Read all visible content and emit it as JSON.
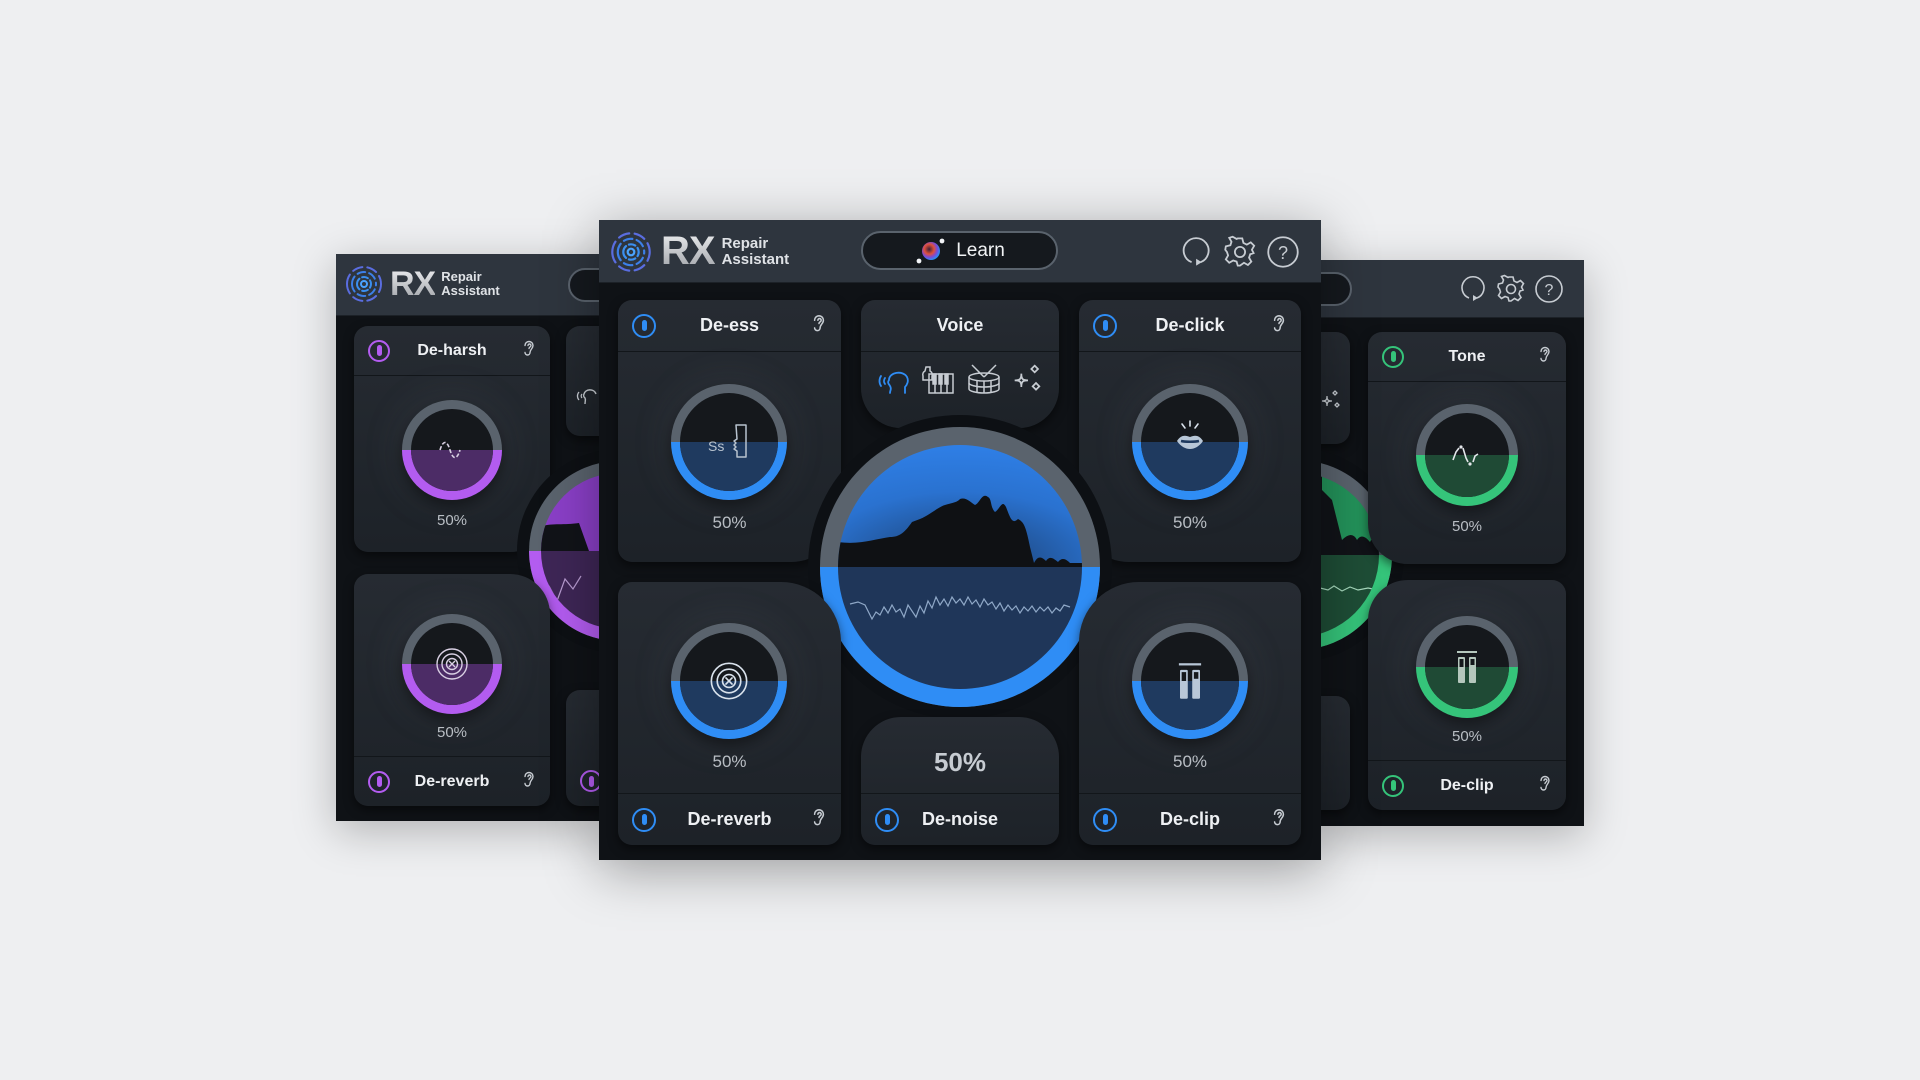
{
  "app": {
    "logo_text": "RX",
    "logo_sub_line1": "Repair",
    "logo_sub_line2": "Assistant",
    "learn_label": "Learn"
  },
  "icons": {
    "logo": "rx-logo-icon",
    "learn": "learn-orb-icon",
    "history": "history-icon",
    "settings": "gear-icon",
    "help": "help-icon",
    "power": "power-icon",
    "listen": "ear-icon"
  },
  "colors": {
    "blue": "#2f8df5",
    "purple": "#b35cf0",
    "green": "#35c47a"
  },
  "left_panel": {
    "accent": "purple",
    "modules": [
      {
        "name": "De-harsh",
        "value": "50%",
        "level": 0.5,
        "icon": "harsh-wave-icon"
      },
      {
        "name": "De-reverb",
        "value": "50%",
        "level": 0.5,
        "icon": "reverb-target-icon"
      }
    ],
    "center_meter_level": 0.5
  },
  "main_panel": {
    "accent": "blue",
    "modules": {
      "de_ess": {
        "name": "De-ess",
        "value": "50%",
        "level": 0.5,
        "icon": "sibilance-face-icon"
      },
      "de_click": {
        "name": "De-click",
        "value": "50%",
        "level": 0.5,
        "icon": "mouth-click-icon"
      },
      "de_reverb": {
        "name": "De-reverb",
        "value": "50%",
        "level": 0.5,
        "icon": "reverb-target-icon"
      },
      "de_clip": {
        "name": "De-clip",
        "value": "50%",
        "level": 0.5,
        "icon": "clip-meter-icon"
      },
      "de_noise": {
        "name": "De-noise",
        "value": "50%",
        "level": 0.5
      }
    },
    "mode": {
      "title": "Voice",
      "options": [
        {
          "name": "voice",
          "icon": "voice-head-icon",
          "selected": true
        },
        {
          "name": "instrument",
          "icon": "instrument-keys-icon",
          "selected": false
        },
        {
          "name": "drums",
          "icon": "drum-icon",
          "selected": false
        },
        {
          "name": "other",
          "icon": "sparkle-icon",
          "selected": false
        }
      ]
    }
  },
  "right_panel": {
    "accent": "green",
    "modules": [
      {
        "name": "Tone",
        "value": "50%",
        "level": 0.5,
        "icon": "tone-curve-icon"
      },
      {
        "name": "De-clip",
        "value": "50%",
        "level": 0.5,
        "icon": "clip-meter-icon"
      }
    ],
    "center_meter_level": 0.5
  }
}
